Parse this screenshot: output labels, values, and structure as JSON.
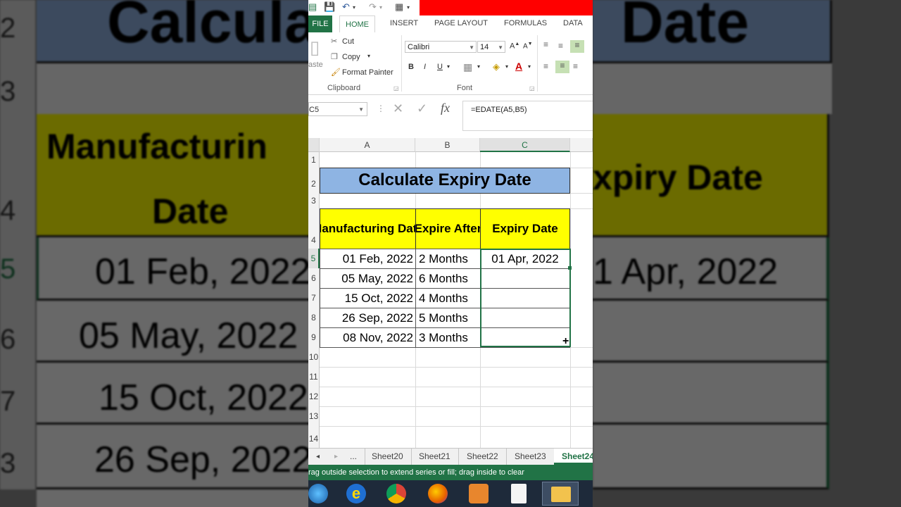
{
  "qat": {
    "undo_icon": "undo-icon",
    "redo_icon": "redo-icon",
    "save_icon": "save-icon"
  },
  "tabs": [
    "FILE",
    "HOME",
    "INSERT",
    "PAGE LAYOUT",
    "FORMULAS",
    "DATA"
  ],
  "ribbon": {
    "cut": "Cut",
    "copy": "Copy",
    "format_painter": "Format Painter",
    "paste": "aste",
    "font_name": "Calibri",
    "font_size": "14",
    "bold": "B",
    "italic": "I",
    "underline": "U",
    "clipboard_group": "Clipboard",
    "font_group": "Font"
  },
  "formula_bar": {
    "name_box": "C5",
    "formula": "=EDATE(A5,B5)",
    "fx": "fx"
  },
  "columns": [
    "A",
    "B",
    "C"
  ],
  "rows": [
    "1",
    "2",
    "3",
    "4",
    "5",
    "6",
    "7",
    "8",
    "9",
    "10",
    "11",
    "12",
    "13",
    "14"
  ],
  "sheet": {
    "title": "Calculate Expiry Date",
    "headers": {
      "a": "Manufacturing Date",
      "b": "Expire After",
      "c": "Expiry Date"
    },
    "data": [
      {
        "date": "01 Feb, 2022",
        "after": "2 Months",
        "expiry": "01 Apr, 2022"
      },
      {
        "date": "05 May, 2022",
        "after": "6 Months",
        "expiry": ""
      },
      {
        "date": "15 Oct, 2022",
        "after": "4 Months",
        "expiry": ""
      },
      {
        "date": "26 Sep, 2022",
        "after": "5 Months",
        "expiry": ""
      },
      {
        "date": "08 Nov, 2022",
        "after": "3 Months",
        "expiry": ""
      }
    ]
  },
  "sheet_tabs": [
    "...",
    "Sheet20",
    "Sheet21",
    "Sheet22",
    "Sheet23",
    "Sheet24"
  ],
  "status_text": "rag outside selection to extend series or fill; drag inside to clear",
  "background": {
    "title_text": "Calcula",
    "title_text_right": "Date",
    "header_left": "Manufacturin",
    "header_left_line2": "Date",
    "header_right": "xpiry Date",
    "row_values": [
      "01 Feb, 2022",
      "05 May, 2022",
      "15 Oct, 2022",
      "26 Sep, 2022"
    ],
    "right_value": "1 Apr, 2022",
    "row_numbers": [
      "2",
      "3",
      "4",
      "5",
      "6",
      "7",
      "3"
    ]
  },
  "colors": {
    "excel_green": "#217346",
    "title_blue": "#8eb4e3",
    "header_yellow": "#ffff00",
    "red_bar": "#ff0000"
  }
}
